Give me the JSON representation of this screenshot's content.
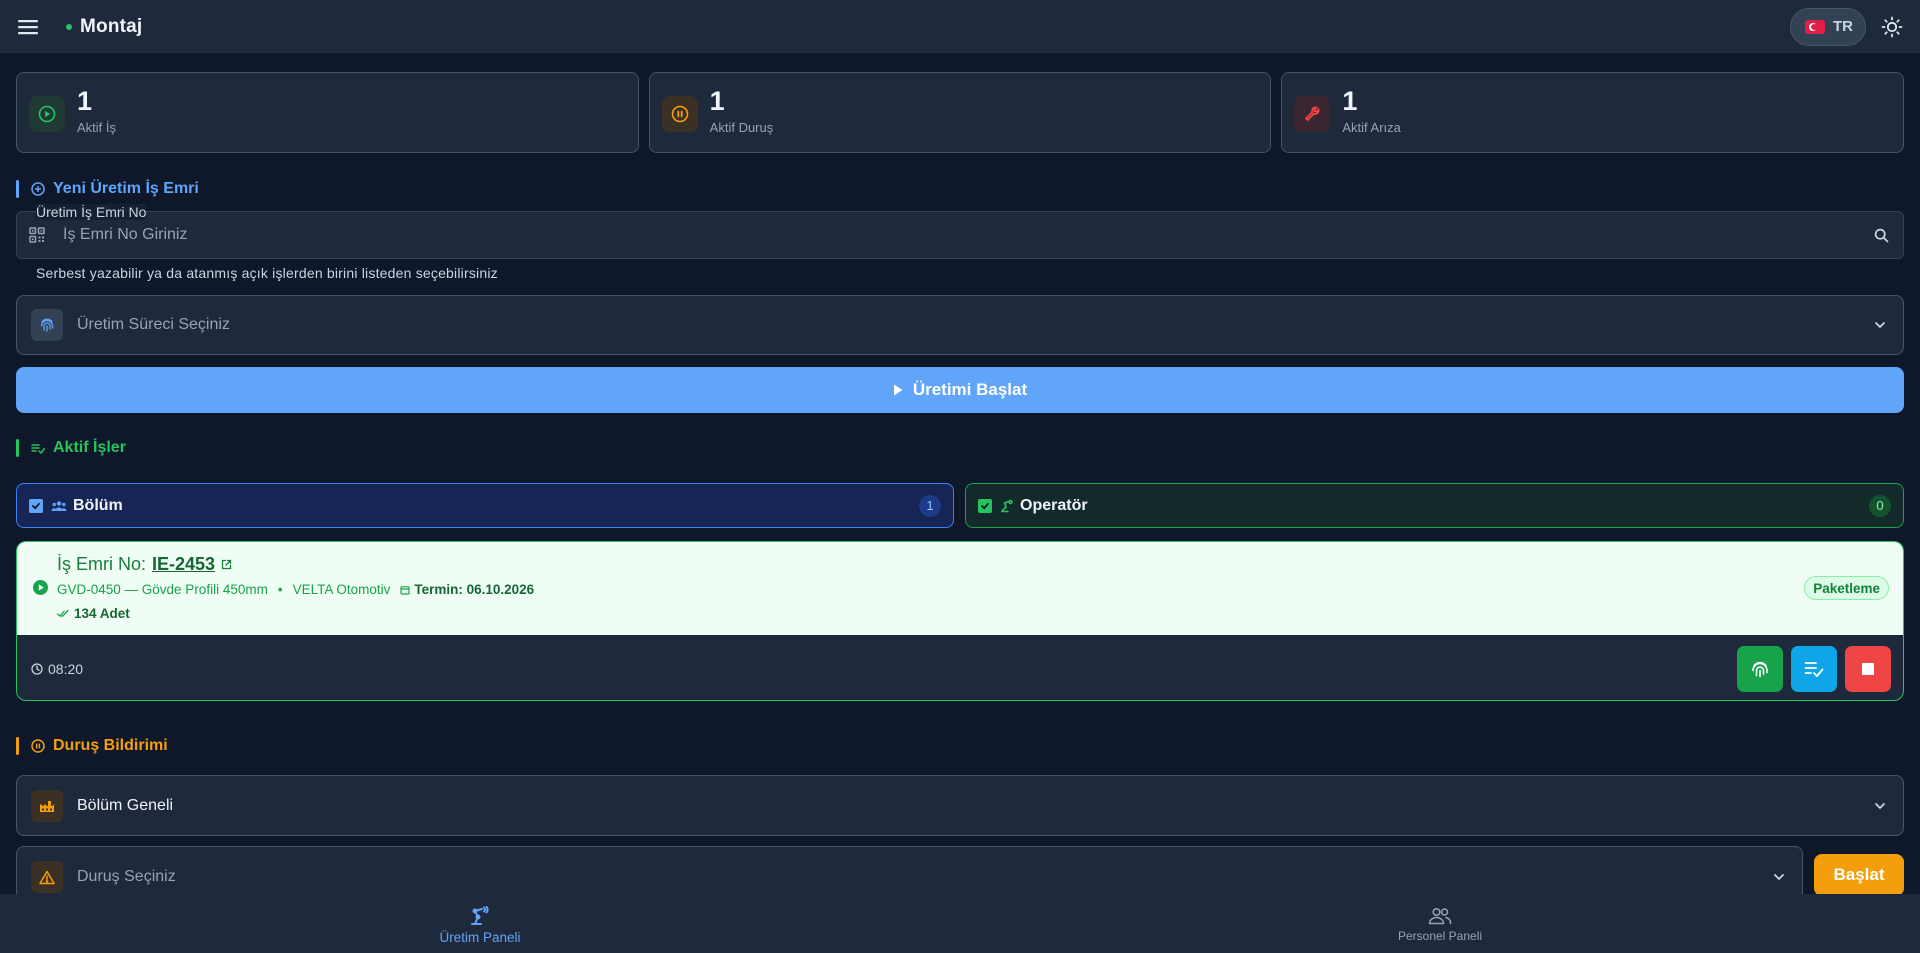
{
  "app": {
    "title": "Montaj",
    "language_code": "TR"
  },
  "stats": [
    {
      "value": "1",
      "label": "Aktif İş",
      "icon": "play-circle-icon",
      "color": "#22c55e"
    },
    {
      "value": "1",
      "label": "Aktif Duruş",
      "icon": "pause-circle-icon",
      "color": "#f59e0b"
    },
    {
      "value": "1",
      "label": "Aktif Arıza",
      "icon": "wrench-icon",
      "color": "#ef4444"
    }
  ],
  "new_order": {
    "section_title": "Yeni Üretim İş Emri",
    "field_label": "Üretim İş Emri No",
    "placeholder": "İş Emri No Giriniz",
    "helper": "Serbest yazabilir ya da atanmış açık işlerden birini listeden seçebilirsiniz",
    "process_placeholder": "Üretim Süreci Seçiniz",
    "start_button": "Üretimi Başlat"
  },
  "active_jobs": {
    "section_title": "Aktif İşler",
    "filters": [
      {
        "label": "Bölüm",
        "count": "1"
      },
      {
        "label": "Operatör",
        "count": "0"
      }
    ],
    "jobs": [
      {
        "title_prefix": "İş Emri No:",
        "order_no": "IE-2453",
        "product": "GVD-0450 — Gövde Profili 450mm",
        "customer": "VELTA Otomotiv",
        "termin": "Termin: 06.10.2026",
        "quantity": "134 Adet",
        "stage": "Paketleme",
        "elapsed": "08:20"
      }
    ]
  },
  "stoppage": {
    "section_title": "Duruş Bildirimi",
    "scope_value": "Bölüm Geneli",
    "reason_placeholder": "Duruş Seçiniz",
    "start_button": "Başlat"
  },
  "bottom_nav": [
    {
      "label": "Üretim Paneli",
      "active": true
    },
    {
      "label": "Personel Paneli",
      "active": false
    }
  ],
  "colors": {
    "accent_blue": "#60a5fa",
    "accent_green": "#22c55e",
    "accent_orange": "#f59e0b",
    "accent_red": "#ef4444",
    "background": "#0f172a",
    "surface": "#1e293b"
  }
}
